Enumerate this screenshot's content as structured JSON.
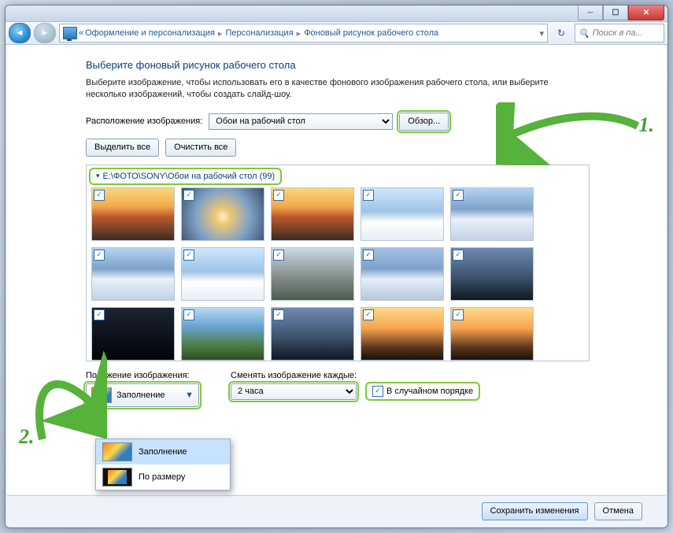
{
  "breadcrumb": {
    "seg1": "Оформление и персонализация",
    "seg2": "Персонализация",
    "seg3": "Фоновый рисунок рабочего стола"
  },
  "search": {
    "placeholder": "Поиск в па..."
  },
  "page": {
    "title": "Выберите фоновый рисунок рабочего стола",
    "subtitle": "Выберите изображение, чтобы использовать его в качестве фонового изображения рабочего стола, или выберите несколько изображений, чтобы создать слайд-шоу."
  },
  "location": {
    "label": "Расположение изображения:",
    "value": "Обои на рабочий стол",
    "browse": "Обзор..."
  },
  "select_all": "Выделить все",
  "clear_all": "Очистить все",
  "folder": {
    "header": "E:\\ФОТО\\SONY\\Обои на рабочий стол (99)"
  },
  "position": {
    "label": "Положение изображения:",
    "selected": "Заполнение",
    "options": [
      "Заполнение",
      "По размеру"
    ]
  },
  "interval": {
    "label": "Сменять изображение каждые:",
    "value": "2 часа"
  },
  "shuffle": {
    "label": "В случайном порядке"
  },
  "footer": {
    "save": "Сохранить изменения",
    "cancel": "Отмена"
  },
  "annotation": {
    "one": "1.",
    "two": "2."
  }
}
